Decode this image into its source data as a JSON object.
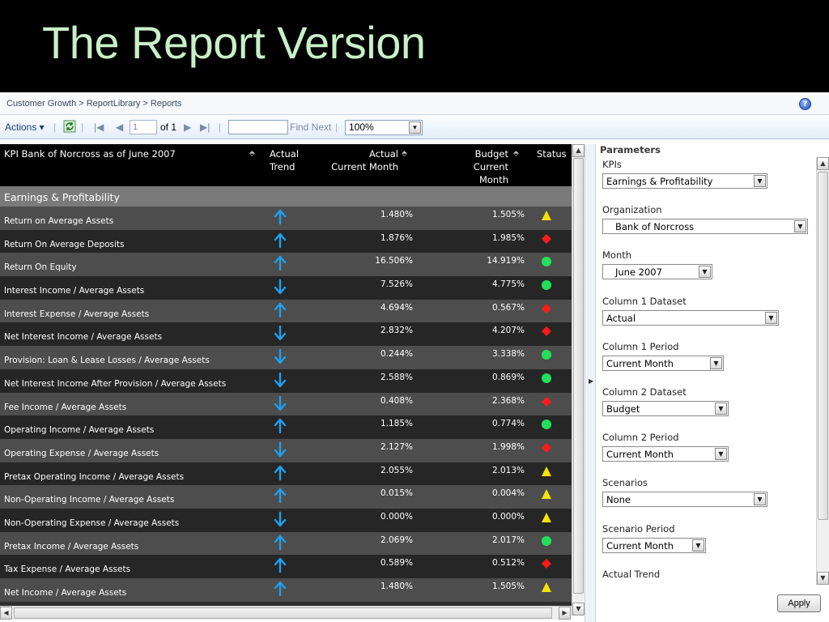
{
  "slide": {
    "title": "The Report Version"
  },
  "breadcrumb": "Customer Growth > ReportLibrary > Reports",
  "toolbar": {
    "actions_label": "Actions ▾",
    "page_value": "1",
    "page_of": "of 1",
    "find_label": "Find Next",
    "zoom_value": "100%"
  },
  "report": {
    "title": "KPI Bank of Norcross as of June 2007",
    "col_trend": [
      "Actual",
      "Trend"
    ],
    "col_actual": [
      "Actual",
      "Current Month"
    ],
    "col_budget": [
      "Budget",
      "Current Month"
    ],
    "col_status": "Status",
    "section": "Earnings & Profitability",
    "colors": {
      "up_arrow": "#1ea0f0",
      "yellow": "#f5e10a",
      "red": "#ff1a1a",
      "green": "#22e05a"
    },
    "rows": [
      {
        "kpi": "Return on Average Assets",
        "trend": "up",
        "actual": "1.480%",
        "budget": "1.505%",
        "status": "yellow-triangle"
      },
      {
        "kpi": "Return On Average Deposits",
        "trend": "up",
        "actual": "1.876%",
        "budget": "1.985%",
        "status": "red-diamond"
      },
      {
        "kpi": "Return On Equity",
        "trend": "up",
        "actual": "16.506%",
        "budget": "14.919%",
        "status": "green-circle"
      },
      {
        "kpi": "Interest Income / Average Assets",
        "trend": "down",
        "actual": "7.526%",
        "budget": "4.775%",
        "status": "green-circle"
      },
      {
        "kpi": "Interest Expense / Average Assets",
        "trend": "up",
        "actual": "4.694%",
        "budget": "0.567%",
        "status": "red-diamond"
      },
      {
        "kpi": "Net Interest Income / Average Assets",
        "trend": "down",
        "actual": "2.832%",
        "budget": "4.207%",
        "status": "red-diamond"
      },
      {
        "kpi": "Provision: Loan & Lease Losses / Average Assets",
        "trend": "down",
        "actual": "0.244%",
        "budget": "3.338%",
        "status": "green-circle"
      },
      {
        "kpi": "Net Interest Income After Provision / Average Assets",
        "trend": "down",
        "actual": "2.588%",
        "budget": "0.869%",
        "status": "green-circle"
      },
      {
        "kpi": "Fee Income / Average Assets",
        "trend": "down",
        "actual": "0.408%",
        "budget": "2.368%",
        "status": "red-diamond"
      },
      {
        "kpi": "Operating Income / Average Assets",
        "trend": "up",
        "actual": "1.185%",
        "budget": "0.774%",
        "status": "green-circle"
      },
      {
        "kpi": "Operating Expense / Average Assets",
        "trend": "down",
        "actual": "2.127%",
        "budget": "1.998%",
        "status": "red-diamond"
      },
      {
        "kpi": "Pretax Operating Income / Average Assets",
        "trend": "up",
        "actual": "2.055%",
        "budget": "2.013%",
        "status": "yellow-triangle"
      },
      {
        "kpi": "Non-Operating Income / Average Assets",
        "trend": "up",
        "actual": "0.015%",
        "budget": "0.004%",
        "status": "yellow-triangle"
      },
      {
        "kpi": "Non-Operating Expense / Average Assets",
        "trend": "down",
        "actual": "0.000%",
        "budget": "0.000%",
        "status": "yellow-triangle"
      },
      {
        "kpi": "Pretax Income / Average Assets",
        "trend": "up",
        "actual": "2.069%",
        "budget": "2.017%",
        "status": "green-circle"
      },
      {
        "kpi": "Tax Expense / Average Assets",
        "trend": "up",
        "actual": "0.589%",
        "budget": "0.512%",
        "status": "red-diamond"
      },
      {
        "kpi": "Net Income / Average Assets",
        "trend": "up",
        "actual": "1.480%",
        "budget": "1.505%",
        "status": "yellow-triangle"
      }
    ]
  },
  "params": {
    "title": "Parameters",
    "apply_label": "Apply",
    "fields": [
      {
        "label": "KPIs",
        "value": "Earnings & Profitability"
      },
      {
        "label": "Organization",
        "value": "   Bank of Norcross"
      },
      {
        "label": "Month",
        "value": "   June 2007"
      },
      {
        "label": "Column 1 Dataset",
        "value": "Actual"
      },
      {
        "label": "Column 1 Period",
        "value": "Current Month"
      },
      {
        "label": "Column 2 Dataset",
        "value": "Budget"
      },
      {
        "label": "Column 2 Period",
        "value": "Current Month"
      },
      {
        "label": "Scenarios",
        "value": "None"
      },
      {
        "label": "Scenario Period",
        "value": "Current Month"
      },
      {
        "label": "Actual Trend",
        "value": ""
      }
    ]
  }
}
